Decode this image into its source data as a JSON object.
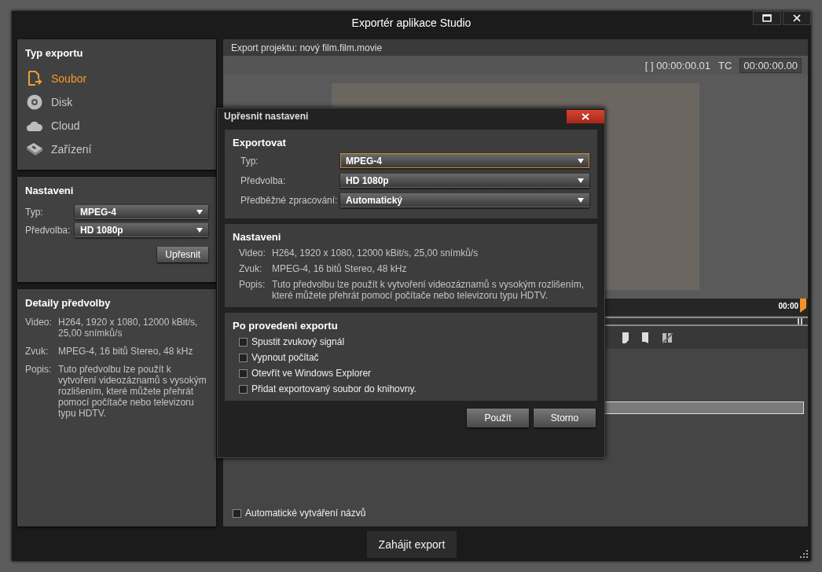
{
  "window": {
    "title": "Exportér aplikace Studio"
  },
  "export_type": {
    "title": "Typ exportu",
    "items": [
      {
        "label": "Soubor",
        "kind": "file",
        "selected": true
      },
      {
        "label": "Disk",
        "kind": "disc",
        "selected": false
      },
      {
        "label": "Cloud",
        "kind": "cloud",
        "selected": false
      },
      {
        "label": "Zařízení",
        "kind": "device",
        "selected": false
      }
    ]
  },
  "settings": {
    "title": "Nastaveni",
    "fields": [
      {
        "label": "Typ:",
        "value": "MPEG-4"
      },
      {
        "label": "Předvolba:",
        "value": "HD 1080p"
      }
    ],
    "button": "Upřesnit"
  },
  "preset_details": {
    "title": "Detaily předvolby",
    "rows": [
      {
        "label": "Video:",
        "value": "H264, 1920 x 1080, 12000 kBit/s, 25,00 snímků/s"
      },
      {
        "label": "Zvuk:",
        "value": "MPEG-4, 16 bitů Stereo, 48 kHz"
      },
      {
        "label": "Popis:",
        "value": "Tuto předvolbu lze použít k vytvoření videozáznamů s vysokým rozlišením, které můžete přehrát pomocí počítače nebo televizoru typu HDTV."
      }
    ]
  },
  "preview": {
    "project_label": "Export projektu: nový film.film.movie",
    "position": "[ ] 00:00:00.01",
    "tc_label": "TC",
    "timecode": "00:00:00.00",
    "time_label": "00:00"
  },
  "progress": {
    "level": 0
  },
  "auto_naming": {
    "label": "Automatické vytváření názvů",
    "checked": false
  },
  "start_button": "Zahájit export",
  "dialog": {
    "title": "Upřesnit nastaveni",
    "export": {
      "title": "Exportovat",
      "fields": [
        {
          "label": "Typ:",
          "value": "MPEG-4",
          "focused": true
        },
        {
          "label": "Předvolba:",
          "value": "HD 1080p",
          "focused": false
        },
        {
          "label": "Předběžné zpracování:",
          "value": "Automatický",
          "focused": false
        }
      ]
    },
    "settings": {
      "title": "Nastaveni",
      "rows": [
        {
          "label": "Video:",
          "value": "H264, 1920 x 1080, 12000 kBit/s, 25,00 snímků/s"
        },
        {
          "label": "Zvuk:",
          "value": "MPEG-4, 16 bitů Stereo, 48 kHz"
        },
        {
          "label": "Popis:",
          "value": "Tuto předvolbu lze použít k vytvoření videozáznamů s vysokým rozlišením, které můžete přehrát pomocí počítače nebo televizoru typu HDTV."
        }
      ]
    },
    "after_export": {
      "title": "Po provedeni exportu",
      "options": [
        {
          "label": "Spustit zvukový signál",
          "checked": false
        },
        {
          "label": "Vypnout počítač",
          "checked": false
        },
        {
          "label": "Otevřít ve Windows Explorer",
          "checked": false
        },
        {
          "label": "Přidat exportovaný soubor do knihovny.",
          "checked": false
        }
      ]
    },
    "buttons": [
      "Použít",
      "Storno"
    ]
  }
}
